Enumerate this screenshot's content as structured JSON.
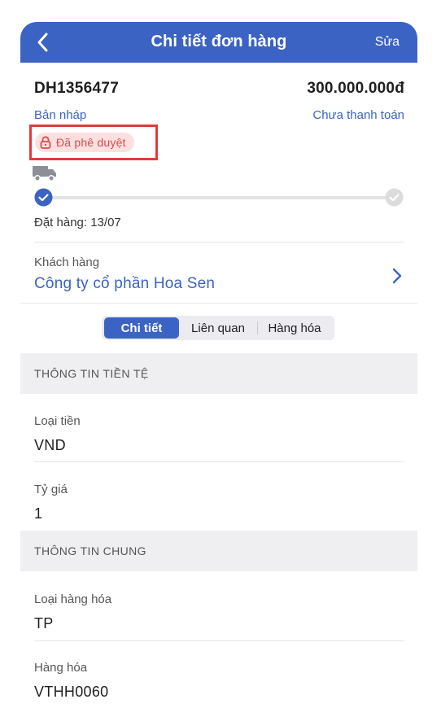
{
  "header": {
    "title": "Chi tiết đơn hàng",
    "edit_label": "Sửa",
    "color": "#3b63c4"
  },
  "order": {
    "code": "DH1356477",
    "amount": "300.000.000đ",
    "status": "Bản nháp",
    "payment_status": "Chưa thanh toán",
    "approval_badge": "Đã phê duyệt",
    "order_date": "Đặt hàng: 13/07"
  },
  "customer": {
    "label": "Khách hàng",
    "name": "Công ty cổ phần Hoa Sen"
  },
  "tabs": [
    {
      "label": "Chi tiết",
      "active": true
    },
    {
      "label": "Liên quan",
      "active": false
    },
    {
      "label": "Hàng hóa",
      "active": false
    }
  ],
  "sections": {
    "currency": {
      "title": "THÔNG TIN TIỀN TỆ",
      "fields": [
        {
          "label": "Loại tiền",
          "value": "VND"
        },
        {
          "label": "Tỷ giá",
          "value": "1"
        }
      ]
    },
    "general": {
      "title": "THÔNG TIN CHUNG",
      "fields": [
        {
          "label": "Loại hàng hóa",
          "value": "TP"
        },
        {
          "label": "Hàng hóa",
          "value": "VTHH0060"
        }
      ]
    }
  },
  "icons": {
    "back": "chevron-left-icon",
    "lock": "lock-icon",
    "truck": "truck-icon",
    "step_done": "check-circle-icon",
    "step_pending": "check-circle-outline-icon",
    "customer_nav": "chevron-right-icon"
  },
  "colors": {
    "primary": "#3b63c4",
    "badge_bg": "#fbe0df",
    "badge_text": "#d94c4c",
    "highlight": "#e23b3b"
  }
}
